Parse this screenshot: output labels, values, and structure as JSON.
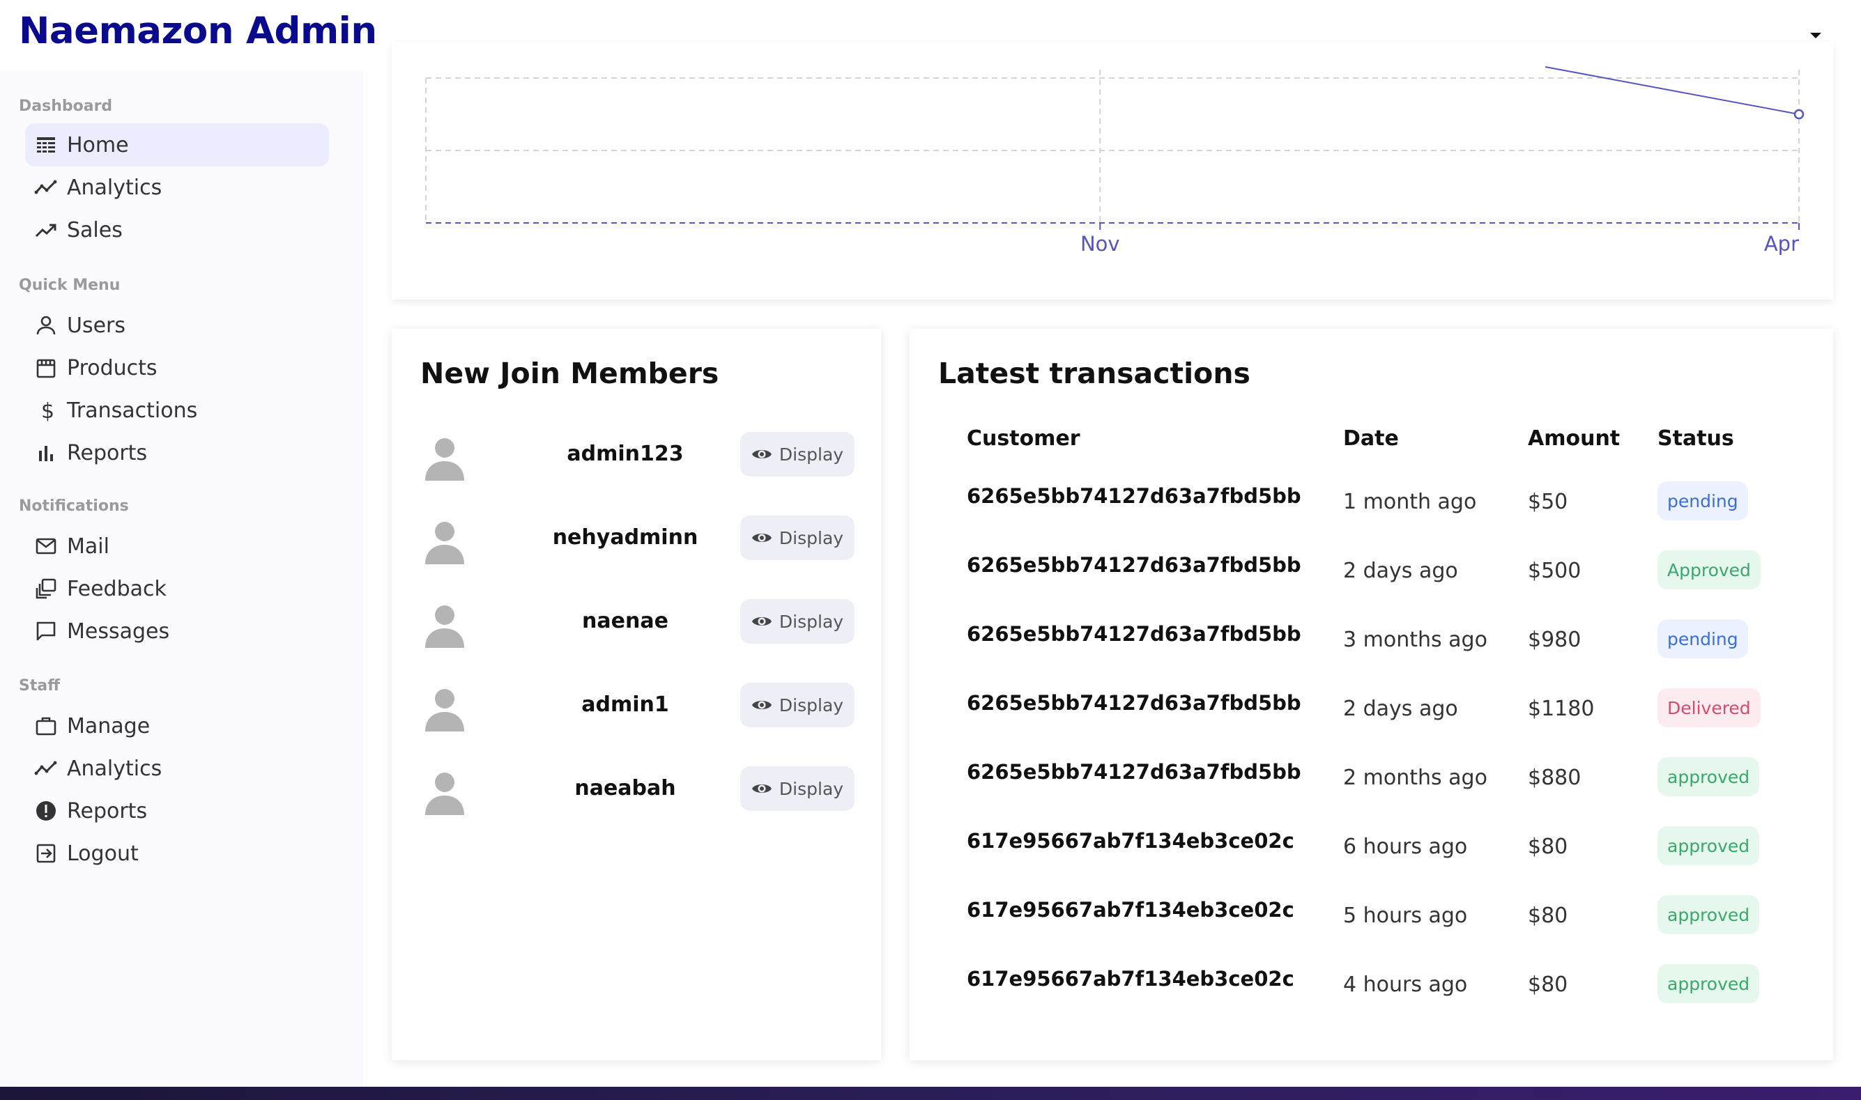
{
  "app": {
    "title": "Naemazon Admin"
  },
  "sidebar": {
    "sections": [
      {
        "title": "Dashboard",
        "items": [
          {
            "label": "Home",
            "icon": "home-icon",
            "active": true
          },
          {
            "label": "Analytics",
            "icon": "timeline-icon"
          },
          {
            "label": "Sales",
            "icon": "trending-up-icon"
          }
        ]
      },
      {
        "title": "Quick Menu",
        "items": [
          {
            "label": "Users",
            "icon": "user-icon"
          },
          {
            "label": "Products",
            "icon": "storefront-icon"
          },
          {
            "label": "Transactions",
            "icon": "dollar-icon"
          },
          {
            "label": "Reports",
            "icon": "bar-chart-icon"
          }
        ]
      },
      {
        "title": "Notifications",
        "items": [
          {
            "label": "Mail",
            "icon": "mail-icon"
          },
          {
            "label": "Feedback",
            "icon": "feedback-icon"
          },
          {
            "label": "Messages",
            "icon": "chat-icon"
          }
        ]
      },
      {
        "title": "Staff",
        "items": [
          {
            "label": "Manage",
            "icon": "briefcase-icon"
          },
          {
            "label": "Analytics",
            "icon": "timeline-icon"
          },
          {
            "label": "Reports",
            "icon": "report-icon"
          },
          {
            "label": "Logout",
            "icon": "logout-icon"
          }
        ]
      }
    ]
  },
  "chart_data": {
    "type": "line",
    "categories": [
      "Nov",
      "Apr"
    ],
    "series": [
      {
        "values": [
          null,
          1
        ]
      }
    ],
    "grid": true
  },
  "members": {
    "title": "New Join Members",
    "button_label": "Display",
    "items": [
      "admin123",
      "nehyadminn",
      "naenae",
      "admin1",
      "naeabah"
    ]
  },
  "transactions": {
    "title": "Latest transactions",
    "headers": {
      "customer": "Customer",
      "date": "Date",
      "amount": "Amount",
      "status": "Status"
    },
    "rows": [
      {
        "customer": "6265e5bb74127d63a7fbd5bb",
        "date": "1 month ago",
        "amount": "$50",
        "status": "pending",
        "type": "pending"
      },
      {
        "customer": "6265e5bb74127d63a7fbd5bb",
        "date": "2 days ago",
        "amount": "$500",
        "status": "Approved",
        "type": "approved"
      },
      {
        "customer": "6265e5bb74127d63a7fbd5bb",
        "date": "3 months ago",
        "amount": "$980",
        "status": "pending",
        "type": "pending"
      },
      {
        "customer": "6265e5bb74127d63a7fbd5bb",
        "date": "2 days ago",
        "amount": "$1180",
        "status": "Delivered",
        "type": "delivered"
      },
      {
        "customer": "6265e5bb74127d63a7fbd5bb",
        "date": "2 months ago",
        "amount": "$880",
        "status": "approved",
        "type": "approved"
      },
      {
        "customer": "617e95667ab7f134eb3ce02c",
        "date": "6 hours ago",
        "amount": "$80",
        "status": "approved",
        "type": "approved"
      },
      {
        "customer": "617e95667ab7f134eb3ce02c",
        "date": "5 hours ago",
        "amount": "$80",
        "status": "approved",
        "type": "approved"
      },
      {
        "customer": "617e95667ab7f134eb3ce02c",
        "date": "4 hours ago",
        "amount": "$80",
        "status": "approved",
        "type": "approved"
      }
    ]
  },
  "colors": {
    "brand": "#0a0a8c",
    "chart_line": "#5555bb"
  }
}
